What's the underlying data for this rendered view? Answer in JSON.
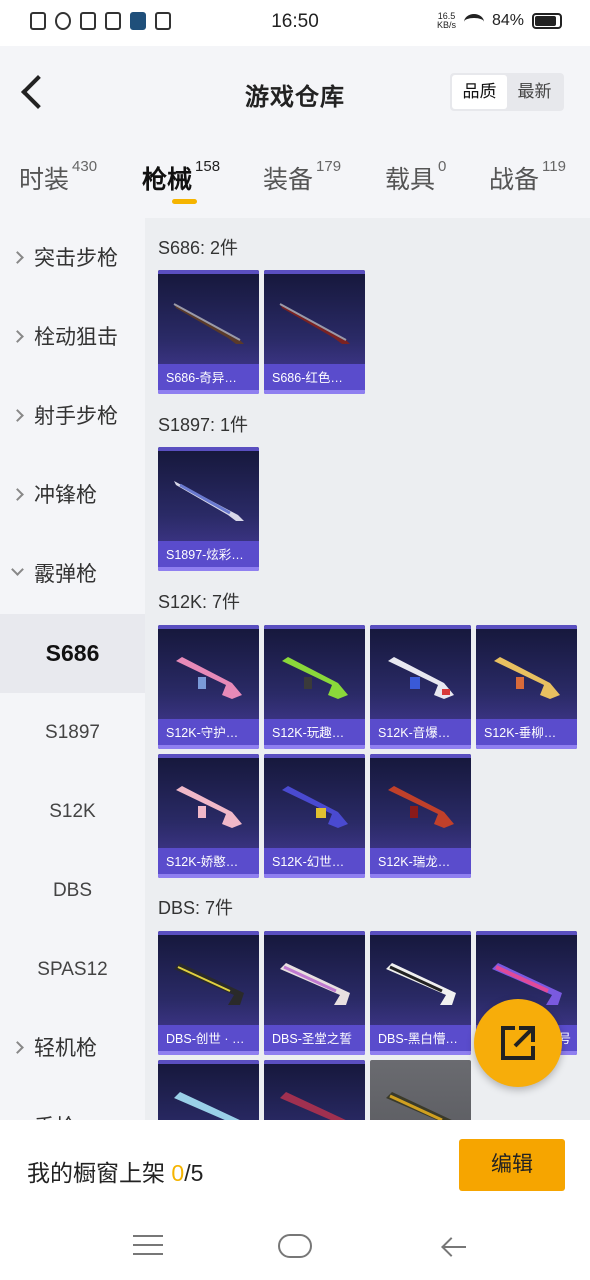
{
  "status_bar": {
    "time": "16:50",
    "net_speed_value": "16.5",
    "net_speed_unit": "KB/s",
    "battery": "84%"
  },
  "header": {
    "title": "游戏仓库",
    "sort_options": [
      "品质",
      "最新"
    ],
    "active_sort": "品质"
  },
  "tabs": [
    {
      "label": "时装",
      "count": "430"
    },
    {
      "label": "枪械",
      "count": "158",
      "active": true
    },
    {
      "label": "装备",
      "count": "179"
    },
    {
      "label": "载具",
      "count": "0"
    },
    {
      "label": "战备",
      "count": "119"
    }
  ],
  "sidebar": {
    "categories": [
      "突击步枪",
      "栓动狙击",
      "射手步枪",
      "冲锋枪"
    ],
    "expanded": "霰弹枪",
    "sub_items": [
      "S686",
      "S1897",
      "S12K",
      "DBS",
      "SPAS12"
    ],
    "active_sub": "S686",
    "after": [
      "轻机枪",
      "手枪"
    ]
  },
  "groups": [
    {
      "title": "S686: 2件",
      "items": [
        "S686-奇异…",
        "S686-红色…"
      ]
    },
    {
      "title": "S1897: 1件",
      "items": [
        "S1897-炫彩…"
      ]
    },
    {
      "title": "S12K: 7件",
      "items": [
        "S12K-守护…",
        "S12K-玩趣…",
        "S12K-音爆…",
        "S12K-垂柳…",
        "S12K-娇憨…",
        "S12K-幻世…",
        "S12K-瑞龙…"
      ]
    },
    {
      "title": "DBS: 7件",
      "items": [
        "DBS-创世 · …",
        "DBS-圣堂之誓",
        "DBS-黑白懵…",
        "号",
        "",
        "",
        ""
      ]
    }
  ],
  "bottom_bar": {
    "label": "我的橱窗上架 ",
    "count": "0",
    "total": "/5",
    "edit_label": "编辑"
  },
  "colors": {
    "accent": "#f5b400",
    "button": "#f6a500",
    "card_caption": "#5a4ccc"
  }
}
